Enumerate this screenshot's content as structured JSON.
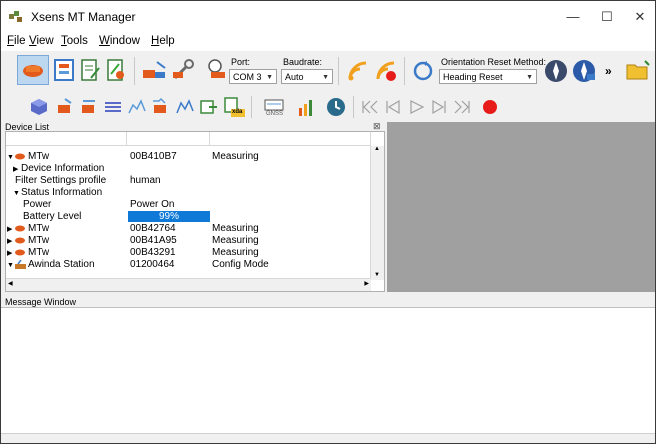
{
  "window": {
    "title": "Xsens MT Manager",
    "minimize": "—",
    "maximize": "☐",
    "close": "✕"
  },
  "menu": [
    {
      "label": "File",
      "accel": "F",
      "rest": "ile"
    },
    {
      "label": "View",
      "accel": "V",
      "rest": "iew"
    },
    {
      "label": "Tools",
      "accel": "T",
      "rest": "ools"
    },
    {
      "label": "Window",
      "accel": "W",
      "rest": "indow"
    },
    {
      "label": "Help",
      "accel": "H",
      "rest": "elp"
    }
  ],
  "toolbar": {
    "port_label": "Port:",
    "port_value": "COM 3",
    "baudrate_label": "Baudrate:",
    "baudrate_value": "Auto",
    "orientation_reset_label": "Orientation Reset Method:",
    "orientation_reset_value": "Heading Reset",
    "overflow": "»",
    "xda_label": "xda",
    "gnss_label": "GNSS"
  },
  "device_list": {
    "title": "Device List",
    "close": "⊠",
    "rows": [
      {
        "col1": "MTw",
        "col2": "00B410B7",
        "col3": "Measuring",
        "type": "device",
        "expanded": true
      },
      {
        "col1": "Device Information",
        "col2": "",
        "col3": "",
        "type": "group",
        "expanded": false
      },
      {
        "col1": "Filter Settings profile",
        "col2": "human",
        "col3": "",
        "type": "prop"
      },
      {
        "col1": "Status Information",
        "col2": "",
        "col3": "",
        "type": "group",
        "expanded": true
      },
      {
        "col1": "Power",
        "col2": "Power On",
        "col3": "",
        "type": "prop2"
      },
      {
        "col1": "Battery Level",
        "col2": "99%",
        "col3": "",
        "type": "battery",
        "level": 0.99
      },
      {
        "col1": "MTw",
        "col2": "00B42764",
        "col3": "Measuring",
        "type": "device",
        "expanded": false
      },
      {
        "col1": "MTw",
        "col2": "00B41A95",
        "col3": "Measuring",
        "type": "device",
        "expanded": false
      },
      {
        "col1": "MTw",
        "col2": "00B43291",
        "col3": "Measuring",
        "type": "device",
        "expanded": false
      },
      {
        "col1": "Awinda Station",
        "col2": "01200464",
        "col3": "Config Mode",
        "type": "station",
        "expanded": true
      }
    ]
  },
  "message_window": {
    "title": "Message Window"
  },
  "colors": {
    "selection": "#0f79d8",
    "panel_gray": "#a0a0a0",
    "record": "#e81b1b"
  }
}
